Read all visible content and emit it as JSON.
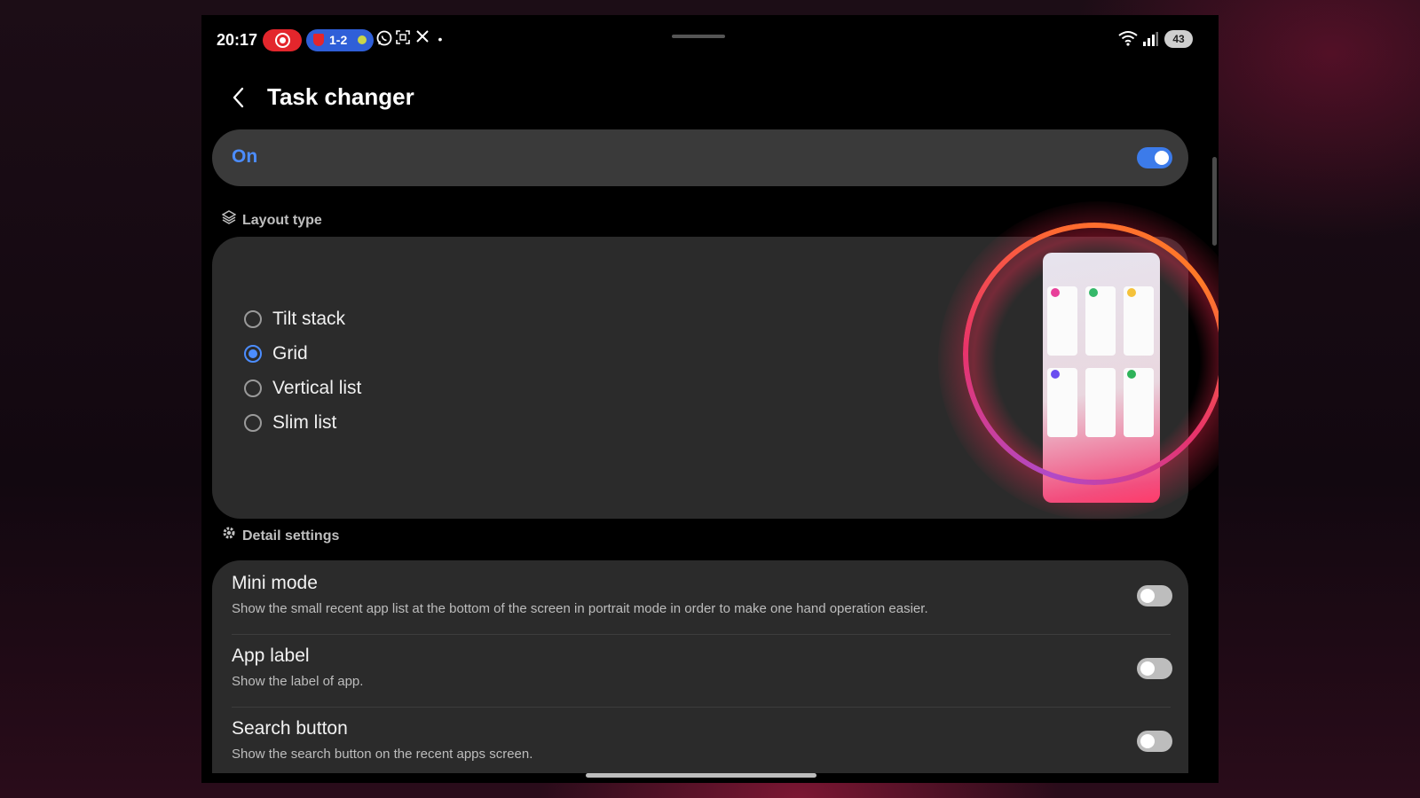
{
  "status_bar": {
    "time": "20:17",
    "score_badge": "1-2",
    "battery": "43",
    "icons": [
      "screen-record-icon",
      "score-badge-icon",
      "whatsapp-icon",
      "screenshot-icon",
      "x-icon",
      "more-dot-icon",
      "wifi-icon",
      "signal-icon",
      "battery-icon"
    ]
  },
  "header": {
    "title": "Task changer",
    "back_icon": "chevron-left-icon"
  },
  "master_switch": {
    "label": "On",
    "state": "on"
  },
  "layout_section": {
    "heading": "Layout type",
    "icon": "layers-icon",
    "options": [
      {
        "label": "Tilt stack",
        "selected": false
      },
      {
        "label": "Grid",
        "selected": true
      },
      {
        "label": "Vertical list",
        "selected": false
      },
      {
        "label": "Slim list",
        "selected": false
      }
    ]
  },
  "detail_section": {
    "heading": "Detail settings",
    "icon": "gear-icon",
    "items": [
      {
        "title": "Mini mode",
        "description": "Show the small recent app list at the bottom of the screen in portrait mode in order to make one hand operation easier.",
        "enabled": false
      },
      {
        "title": "App label",
        "description": "Show the label of app.",
        "enabled": false
      },
      {
        "title": "Search button",
        "description": "Show the search button on the recent apps screen.",
        "enabled": false
      }
    ]
  },
  "colors": {
    "accent": "#4c8dff",
    "toggle_on": "#3c7bea",
    "card_bg": "#2b2b2b",
    "highlight_ring": "#e8336a"
  }
}
